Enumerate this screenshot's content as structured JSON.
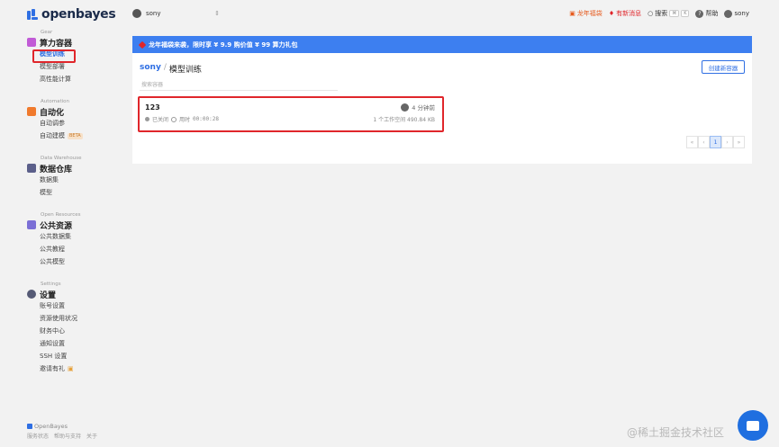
{
  "brand": {
    "name": "openbayes",
    "footer_name": "OpenBayes"
  },
  "workspace": {
    "name": "sony"
  },
  "topbar": {
    "promo": "龙年福袋",
    "news": "有新消息",
    "search": "搜索",
    "shortcut": "⌘",
    "shortcut_key": "K",
    "help": "帮助",
    "user": "sony"
  },
  "sidebar": {
    "sections": [
      {
        "en": "Gear",
        "title": "算力容器",
        "items": [
          {
            "label": "模型训练",
            "active": true
          },
          {
            "label": "模型部署"
          },
          {
            "label": "高性能计算"
          }
        ]
      },
      {
        "en": "Automation",
        "title": "自动化",
        "items": [
          {
            "label": "自动调参"
          },
          {
            "label": "自动建模",
            "badge": "BETA"
          }
        ]
      },
      {
        "en": "Data Warehouse",
        "title": "数据仓库",
        "items": [
          {
            "label": "数据集"
          },
          {
            "label": "模型"
          }
        ]
      },
      {
        "en": "Open Resources",
        "title": "公共资源",
        "items": [
          {
            "label": "公共数据集"
          },
          {
            "label": "公共教程"
          },
          {
            "label": "公共模型"
          }
        ]
      },
      {
        "en": "Settings",
        "title": "设置",
        "items": [
          {
            "label": "账号设置"
          },
          {
            "label": "资源使用状况"
          },
          {
            "label": "财务中心"
          },
          {
            "label": "通知设置"
          },
          {
            "label": "SSH 设置"
          },
          {
            "label": "邀请有礼"
          }
        ]
      }
    ],
    "footer_links": [
      "服务状态",
      "帮助与支持",
      "关于"
    ]
  },
  "banner": {
    "text": "龙年福袋来袭，限时享 ¥ 9.9 购价值 ¥ 99 算力礼包"
  },
  "main": {
    "breadcrumb_ws": "sony",
    "breadcrumb_sep": "/",
    "title": "模型训练",
    "create_button": "创建新容器",
    "search_placeholder": "搜索容器",
    "container": {
      "name": "123",
      "status": "已关闭",
      "runtime_label": "用时",
      "runtime": "00:00:28",
      "updated": "4 分钟前",
      "summary": "1 个工作空间",
      "size": "490.84 KB"
    },
    "pager": {
      "first": "«",
      "prev": "‹",
      "current": "1",
      "next": "›",
      "last": "»"
    }
  },
  "watermark": "@稀土掘金技术社区",
  "colors": {
    "accent": "#2f6fe3",
    "banner": "#3d7ff0",
    "highlight": "#e0262b"
  }
}
